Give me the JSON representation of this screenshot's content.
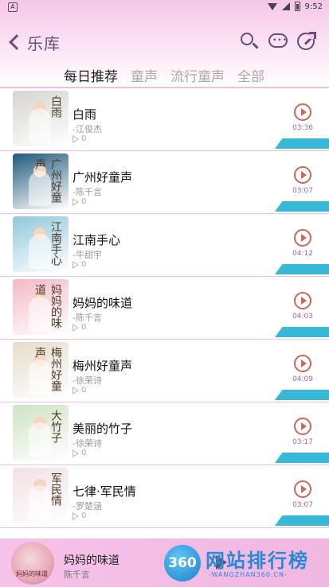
{
  "status_bar": {
    "time": "9:52",
    "left_badge": "A"
  },
  "header": {
    "title": "乐库"
  },
  "tabs": [
    {
      "label": "每日推荐",
      "active": true
    },
    {
      "label": "童声",
      "active": false
    },
    {
      "label": "流行童声",
      "active": false
    },
    {
      "label": "全部",
      "active": false
    }
  ],
  "colors": {
    "accent_purple": "#6a4c7a",
    "play_button": "#c9695e",
    "duration_text": "#9a6ba1",
    "accent_tab": "#36b8d6",
    "header_pink": "#f6c6e8"
  },
  "songs": [
    {
      "title": "白雨",
      "artist": "-江俊杰",
      "plays": "0",
      "duration": "03:36",
      "cover_text": "白雨",
      "cover_color": "#d7d4cf"
    },
    {
      "title": "广州好童声",
      "artist": "-陈千言",
      "plays": "0",
      "duration": "03:07",
      "cover_text": "广州好童声",
      "cover_color": "#1f5a7a"
    },
    {
      "title": "江南手心",
      "artist": "-牛甜宇",
      "plays": "0",
      "duration": "04:12",
      "cover_text": "江南手心",
      "cover_color": "#8fc9d9"
    },
    {
      "title": "妈妈的味道",
      "artist": "-陈千言",
      "plays": "0",
      "duration": "04:03",
      "cover_text": "妈妈的味道",
      "cover_color": "#f3b9c6"
    },
    {
      "title": "梅州好童声",
      "artist": "-徐荣诗",
      "plays": "0",
      "duration": "04:09",
      "cover_text": "梅州好童声",
      "cover_color": "#e6dccb"
    },
    {
      "title": "美丽的竹子",
      "artist": "-徐荣诗",
      "plays": "0",
      "duration": "03:17",
      "cover_text": "大竹子",
      "cover_color": "#cfe3c4"
    },
    {
      "title": "七律·军民情",
      "artist": "-罗楚涵",
      "plays": "0",
      "duration": "03:07",
      "cover_text": "军民情",
      "cover_color": "#f1e1e4"
    }
  ],
  "player": {
    "title": "妈妈的味道",
    "artist": "陈千言",
    "cover_text": "妈妈的味道"
  },
  "watermark": {
    "logo": "360",
    "text": "网站排行榜",
    "sub": "-WANGZHAN360.CN-"
  }
}
